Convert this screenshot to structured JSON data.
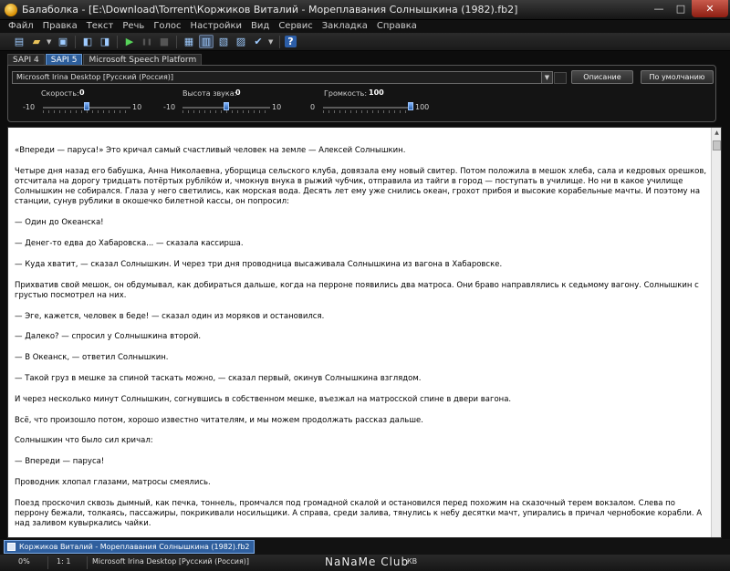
{
  "window": {
    "title": "Балаболка - [E:\\Download\\Torrent\\Коржиков Виталий - Мореплавания Солнышкина (1982).fb2]",
    "minimize_glyph": "—",
    "maximize_glyph": "□",
    "close_glyph": "✕"
  },
  "menu": [
    "Файл",
    "Правка",
    "Текст",
    "Речь",
    "Голос",
    "Настройки",
    "Вид",
    "Сервис",
    "Закладка",
    "Справка"
  ],
  "toolbar": {
    "icons": [
      "new-document-icon",
      "open-folder-icon",
      "save-icon",
      "save-audio-icon",
      "export-icon",
      "play-icon",
      "pause-icon",
      "stop-icon",
      "read-clipboard-icon",
      "view-text-icon",
      "file-split-icon",
      "batch-convert-icon",
      "spell-check-icon",
      "help-icon"
    ],
    "glyphs": {
      "new": "▤",
      "open": "▰",
      "drop": "▼",
      "save": "▣",
      "save_audio": "◧",
      "export": "◨",
      "play": "▶",
      "pause": "❚❚",
      "stop": "■",
      "clipboard": "▦",
      "view": "▥",
      "split": "▧",
      "batch": "▨",
      "spell": "✔",
      "help": "?"
    }
  },
  "sapi_tabs": [
    "SAPI 4",
    "SAPI 5",
    "Microsoft Speech Platform"
  ],
  "sapi_active": 1,
  "voice": {
    "selected": "Microsoft Irina Desktop [Русский (Россия)]",
    "arrow": "▼",
    "description_button": "Описание",
    "default_button": "По умолчанию"
  },
  "params": {
    "speed": {
      "label": "Скорость:",
      "value": "0",
      "min": "-10",
      "max": "10",
      "fraction": 0.5
    },
    "pitch": {
      "label": "Высота звука:",
      "value": "0",
      "min": "-10",
      "max": "10",
      "fraction": 0.5
    },
    "volume": {
      "label": "Громкость:",
      "value": "100",
      "min": "0",
      "max": "100",
      "fraction": 1.0
    }
  },
  "text": [
    "«Впереди — паруса!» Это кричал самый счастливый человек на земле — Алексей Солнышкин.",
    "Четыре дня назад его бабушка, Анна Николаевна, уборщица сельского клуба, довязала ему новый свитер. Потом положила в мешок хлеба, сала и кедровых орешков, отсчитала на дорогу тридцать потёртых рублików и, чмокнув внука в рыжий чубчик, отправила из тайги в город — поступать в училище. Но ни в какое училище Солнышкин не собирался. Глаза у него светились, как морская вода. Десять лет ему уже снились океан, грохот прибоя и высокие корабельные мачты. И поэтому на станции, сунув рублики в окошечко билетной кассы, он попросил:",
    "— Один до Океанска!",
    "— Денег-то едва до Хабаровска... — сказала кассирша.",
    "— Куда хватит, — сказал Солнышкин. И через три дня проводница высаживала Солнышкина из вагона в Хабаровске.",
    "Прихватив свой мешок, он обдумывал, как добираться дальше, когда на перроне появились два матроса. Они браво направлялись к седьмому вагону. Солнышкин с грустью посмотрел на них.",
    "— Эге, кажется, человек в беде! — сказал один из моряков и остановился.",
    "— Далеко? — спросил у Солнышкина второй.",
    "— В Океанск, — ответил Солнышкин.",
    "— Такой груз в мешке за спиной таскать можно, — сказал первый, окинув Солнышкина взглядом.",
    "И через несколько минут Солнышкин, согнувшись в собственном мешке, въезжал на матросской спине в двери вагона.",
    "Всё, что произошло потом, хорошо известно читателям, и мы можем продолжать рассказ дальше.",
    "Солнышкин что было сил кричал:",
    "— Впереди — паруса!",
    "Проводник хлопал глазами, матросы смеялись.",
    "Поезд проскочил сквозь дымный, как печка, тоннель, промчался под громадной скалой и остановился перед похожим на сказочный терем вокзалом. Слева по перрону бежали, толкаясь, пассажиры, покрикивали носильщики. А справа, среди залива, тянулись к небу десятки мачт, упирались в причал чернобокие корабли. А над заливом кувыркались чайки."
  ],
  "scrollbar": {
    "up_arrow": "▲"
  },
  "document_tab": "Коржиков Виталий - Мореплавания Солнышкина (1982).fb2",
  "status": {
    "progress": "0%",
    "position": "1:    1",
    "voice": "Microsoft Irina Desktop [Русский (Россия)]",
    "size_suffix": "КВ",
    "watermark": "NaNaMe Club"
  }
}
